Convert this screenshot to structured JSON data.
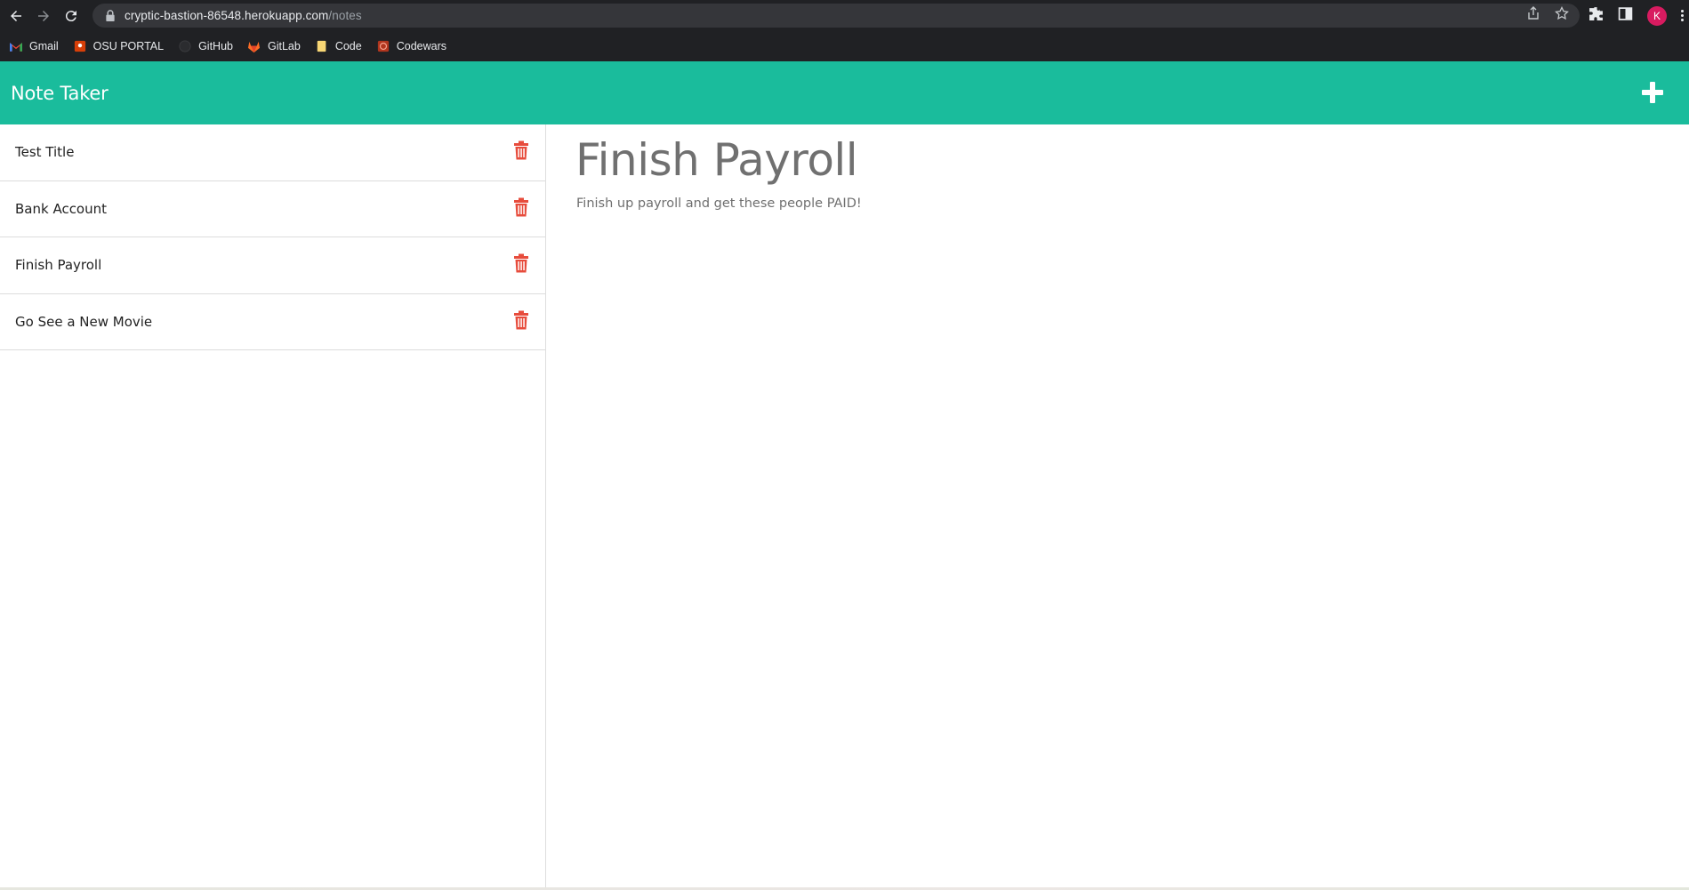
{
  "browser": {
    "url_host": "cryptic-bastion-86548.herokuapp.com",
    "url_path": "/notes",
    "profile_initial": "K",
    "bookmarks": [
      {
        "label": "Gmail",
        "icon": "gmail-icon"
      },
      {
        "label": "OSU PORTAL",
        "icon": "osu-icon"
      },
      {
        "label": "GitHub",
        "icon": "github-icon"
      },
      {
        "label": "GitLab",
        "icon": "gitlab-icon"
      },
      {
        "label": "Code",
        "icon": "folder-icon"
      },
      {
        "label": "Codewars",
        "icon": "codewars-icon"
      }
    ]
  },
  "app": {
    "brand": "Note Taker",
    "accent_color": "#1abc9c",
    "delete_color": "#e74c3c"
  },
  "notes": [
    {
      "title": "Test Title"
    },
    {
      "title": "Bank Account"
    },
    {
      "title": "Finish Payroll"
    },
    {
      "title": "Go See a New Movie"
    }
  ],
  "active_note": {
    "title": "Finish Payroll",
    "text": "Finish up payroll and get these people PAID!"
  }
}
